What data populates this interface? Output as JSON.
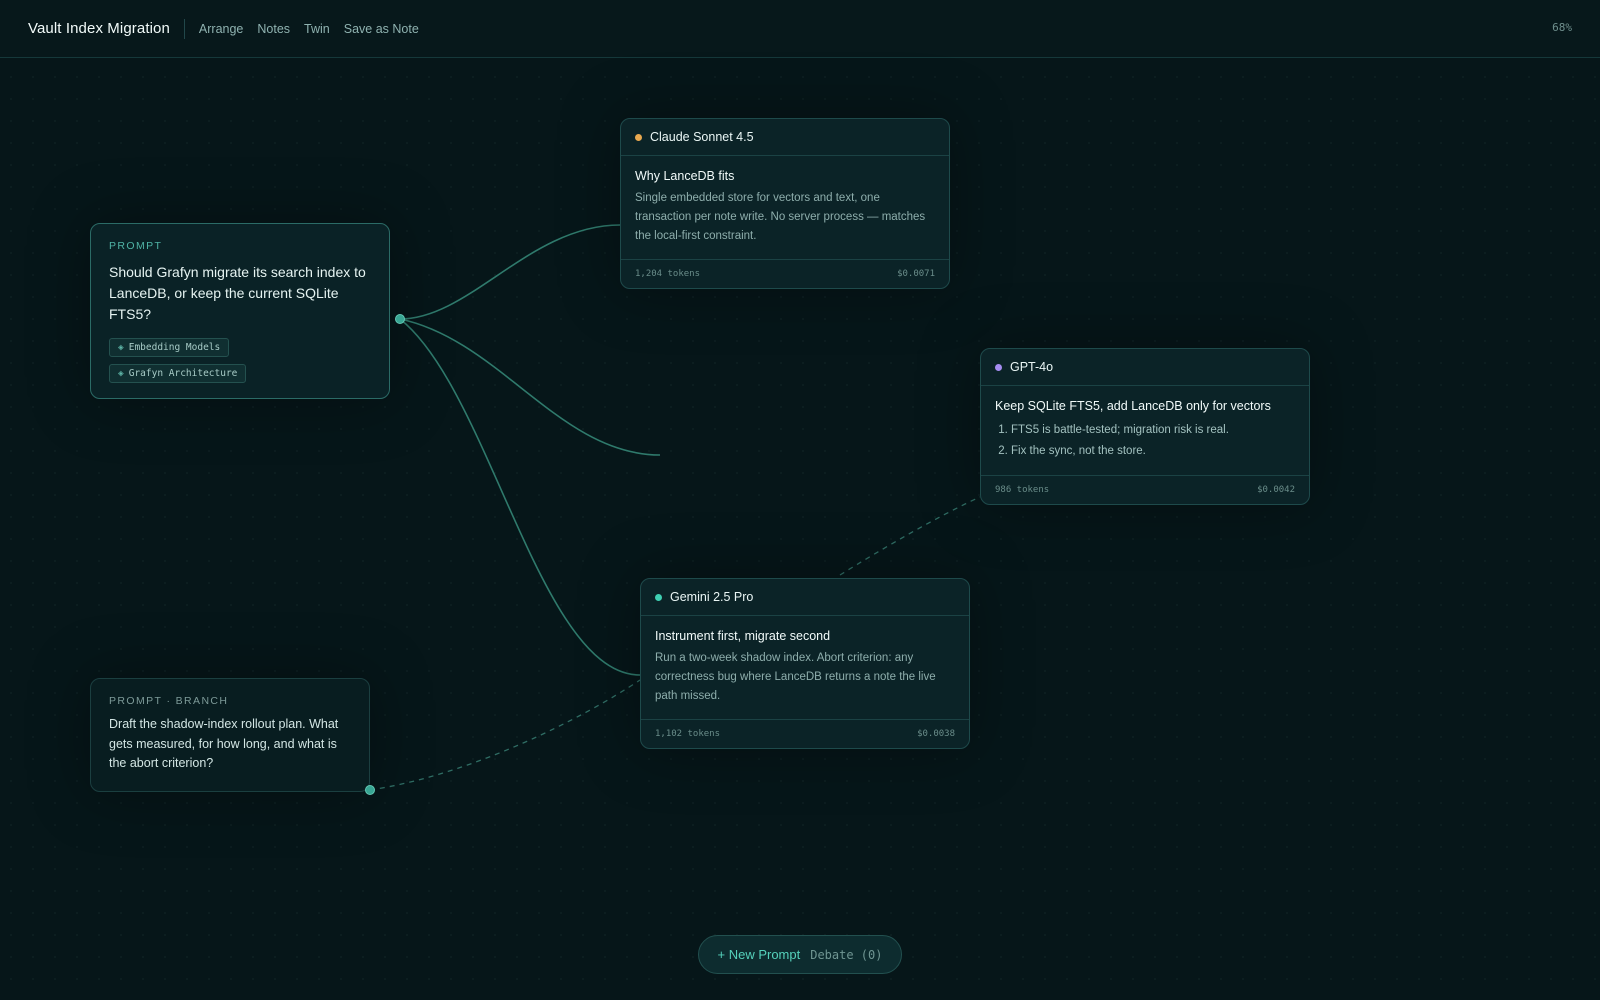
{
  "header": {
    "title": "Vault Index Migration",
    "menu": [
      "Arrange",
      "Notes",
      "Twin",
      "Save as Note"
    ],
    "zoom": "68%"
  },
  "prompt": {
    "kicker": "PROMPT",
    "text": "Should Grafyn migrate its search index to LanceDB, or keep the current SQLite FTS5?",
    "tag_icon": "diamond-icon",
    "tags": [
      "Embedding Models",
      "Grafyn Architecture"
    ]
  },
  "branch": {
    "kicker": "PROMPT · BRANCH",
    "text": "Draft the shadow-index rollout plan. What gets measured, for how long, and what is the abort criterion?"
  },
  "cards": {
    "claude": {
      "model": "Claude Sonnet 4.5",
      "dot_color": "#e8a84f",
      "title": "Why LanceDB fits",
      "text": "Single embedded store for vectors and text, one transaction per note write. No server process — matches the local-first constraint.",
      "tokens": "1,204 tokens",
      "cost": "$0.0071"
    },
    "gpt": {
      "model": "GPT-4o",
      "dot_color": "#a58cf0",
      "title": "Keep SQLite FTS5, add LanceDB only for vectors",
      "points": [
        "FTS5 is battle-tested; migration risk is real.",
        "Fix the sync, not the store."
      ],
      "tokens": "986 tokens",
      "cost": "$0.0042"
    },
    "gemini": {
      "model": "Gemini 2.5 Pro",
      "dot_color": "#3fcfb2",
      "title": "Instrument first, migrate second",
      "text": "Run a two-week shadow index. Abort criterion: any correctness bug where LanceDB returns a note the live path missed.",
      "tokens": "1,102 tokens",
      "cost": "$0.0038"
    }
  },
  "bottom": {
    "new_prompt": "+ New Prompt",
    "debate": "Debate (0)"
  },
  "colors": {
    "background": "#061619",
    "accent": "#55d1bb",
    "wire": "#2f7a6c"
  }
}
